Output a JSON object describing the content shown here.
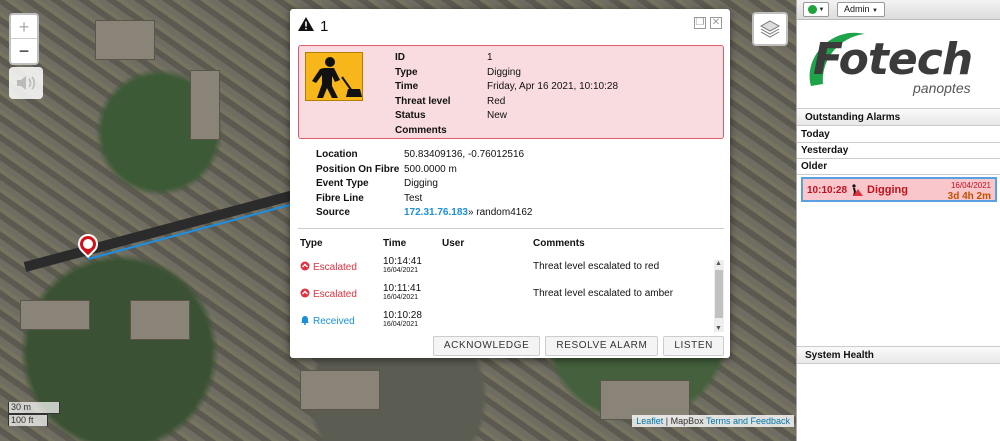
{
  "map": {
    "zoom_in_label": "+",
    "zoom_out_label": "−",
    "scale_metric": "30 m",
    "scale_imperial": "100 ft",
    "attribution_leaflet": "Leaflet",
    "attribution_sep": " | MapBox ",
    "attribution_terms": "Terms and Feedback"
  },
  "popup": {
    "title": "1",
    "alarm": [
      {
        "key": "ID",
        "value": "1"
      },
      {
        "key": "Type",
        "value": "Digging"
      },
      {
        "key": "Time",
        "value": "Friday, Apr 16 2021, 10:10:28"
      },
      {
        "key": "Threat level",
        "value": "Red"
      },
      {
        "key": "Status",
        "value": "New"
      },
      {
        "key": "Comments",
        "value": ""
      }
    ],
    "info": [
      {
        "key": "Location",
        "value": "50.83409136, -0.76012516"
      },
      {
        "key": "Position On Fibre",
        "value": "500.0000 m"
      },
      {
        "key": "Event Type",
        "value": "Digging"
      },
      {
        "key": "Fibre Line",
        "value": "Test"
      }
    ],
    "source": {
      "key": "Source",
      "ip": "172.31.76.183",
      "suffix": "» random4162"
    },
    "history_headers": {
      "type": "Type",
      "time": "Time",
      "user": "User",
      "comments": "Comments"
    },
    "history": [
      {
        "type": "Escalated",
        "time": "10:14:41",
        "date": "16/04/2021",
        "user": "",
        "comment": "Threat level escalated to red"
      },
      {
        "type": "Escalated",
        "time": "10:11:41",
        "date": "16/04/2021",
        "user": "",
        "comment": "Threat level escalated to amber"
      },
      {
        "type": "Received",
        "time": "10:10:28",
        "date": "16/04/2021",
        "user": "",
        "comment": ""
      }
    ],
    "buttons": {
      "acknowledge": "ACKNOWLEDGE",
      "resolve": "RESOLVE ALARM",
      "listen": "LISTEN"
    }
  },
  "panel": {
    "admin_label": "Admin",
    "logo_text": "Fotech",
    "logo_sub": "panoptes",
    "outstanding_title": "Outstanding Alarms",
    "groups": {
      "today": "Today",
      "yesterday": "Yesterday",
      "older": "Older"
    },
    "alarm_card": {
      "time": "10:10:28",
      "type": "Digging",
      "date": "16/04/2021",
      "age": "3d 4h 2m"
    },
    "system_health_title": "System Health"
  },
  "colors": {
    "threat_red": "#e0323e",
    "fibre": "#1a8fe3",
    "brand_green": "#1fa34a"
  }
}
